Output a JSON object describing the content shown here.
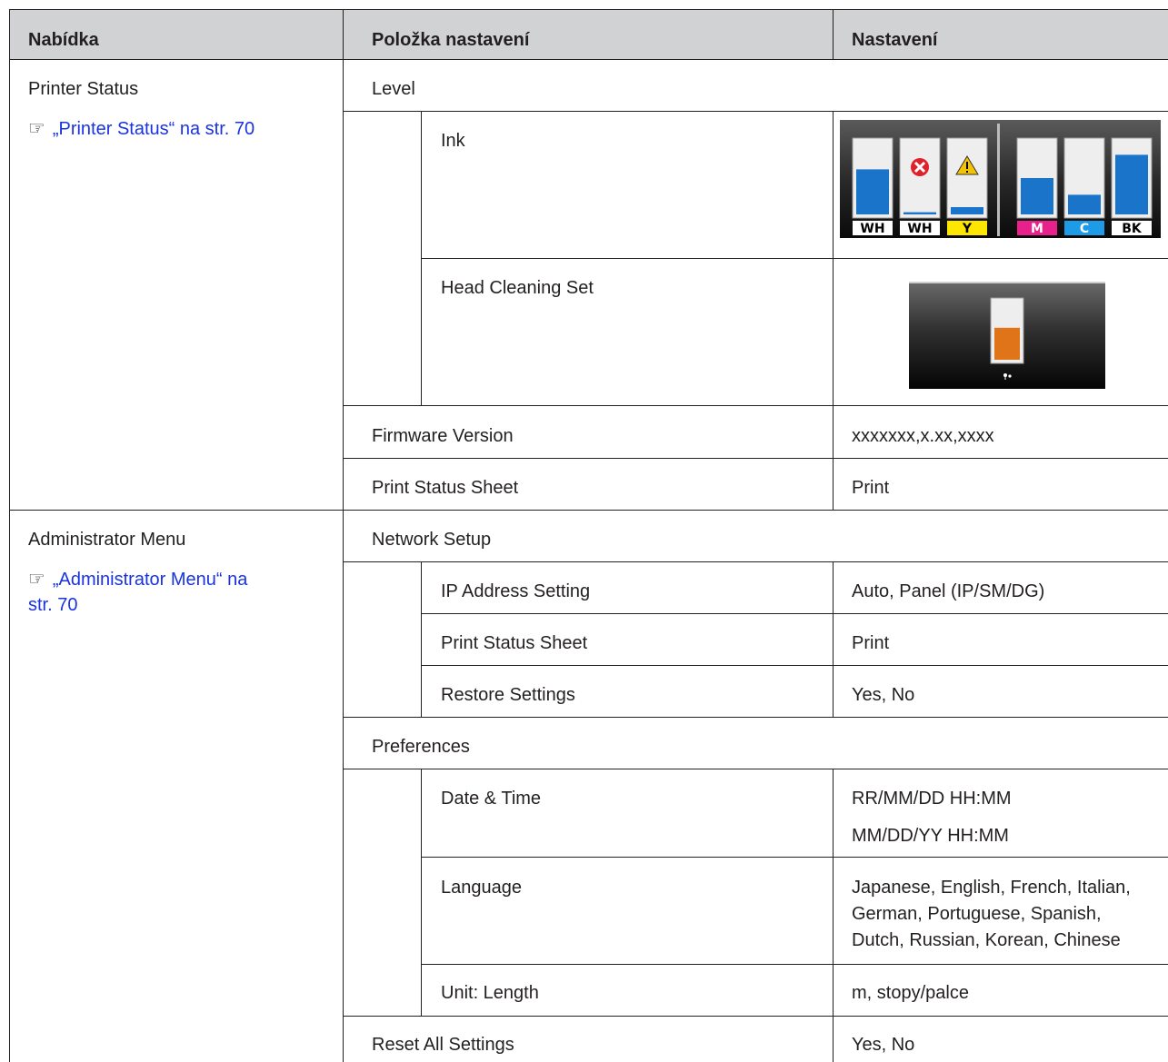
{
  "header": {
    "col1": "Nabídka",
    "col2": "Položka nastavení",
    "col3": "Nastavení"
  },
  "sections": {
    "printer_status": {
      "menu": "Printer Status",
      "link": "„Printer Status“ na str. 70",
      "level": "Level",
      "ink": "Ink",
      "head_cleaning_set": "Head Cleaning Set",
      "firmware_version": "Firmware Version",
      "firmware_value": "xxxxxxx,x.xx,xxxx",
      "print_status_sheet": "Print Status Sheet",
      "print_status_value": "Print"
    },
    "administrator_menu": {
      "menu": "Administrator Menu",
      "link_line1": "„Administrator Menu“ na",
      "link_line2": "str. 70",
      "network_setup": "Network Setup",
      "ip_address_setting": "IP Address Setting",
      "ip_address_value": "Auto, Panel (IP/SM/DG)",
      "print_status_sheet": "Print Status Sheet",
      "print_status_value": "Print",
      "restore_settings": "Restore Settings",
      "restore_value": "Yes, No",
      "preferences": "Preferences",
      "date_time": "Date & Time",
      "date_value_1": "RR/MM/DD HH:MM",
      "date_value_2": "MM/DD/YY HH:MM",
      "language": "Language",
      "language_value_1": "Japanese, English, French, Italian,",
      "language_value_2": "German, Portuguese, Spanish,",
      "language_value_3": "Dutch, Russian, Korean, Chinese",
      "unit_length": "Unit: Length",
      "unit_length_value": "m, stopy/palce",
      "reset_all_settings": "Reset All Settings",
      "reset_value": "Yes, No"
    }
  },
  "ink_panel": {
    "labels": [
      "WH",
      "WH",
      "Y",
      "M",
      "C",
      "BK"
    ],
    "levels": [
      0.62,
      0.03,
      0.1,
      0.5,
      0.27,
      0.82
    ],
    "label_colors": [
      "#ffffff",
      "#ffffff",
      "#ffe600",
      "#e8208c",
      "#1e9be6",
      "#ffffff"
    ],
    "label_text_colors": [
      "#000000",
      "#000000",
      "#000000",
      "#ffffff",
      "#ffffff",
      "#000000"
    ],
    "fill_color": "#1a74c9",
    "error_icon": "error-x-icon",
    "warning_icon": "warning-triangle-icon"
  },
  "head_cleaning_panel": {
    "level": 0.55,
    "fill_color": "#e07418",
    "icon": "maintenance-drops-icon"
  },
  "colors": {
    "header_bg": "#d1d2d4",
    "link": "#1a33e0",
    "rule": "#231f20"
  }
}
